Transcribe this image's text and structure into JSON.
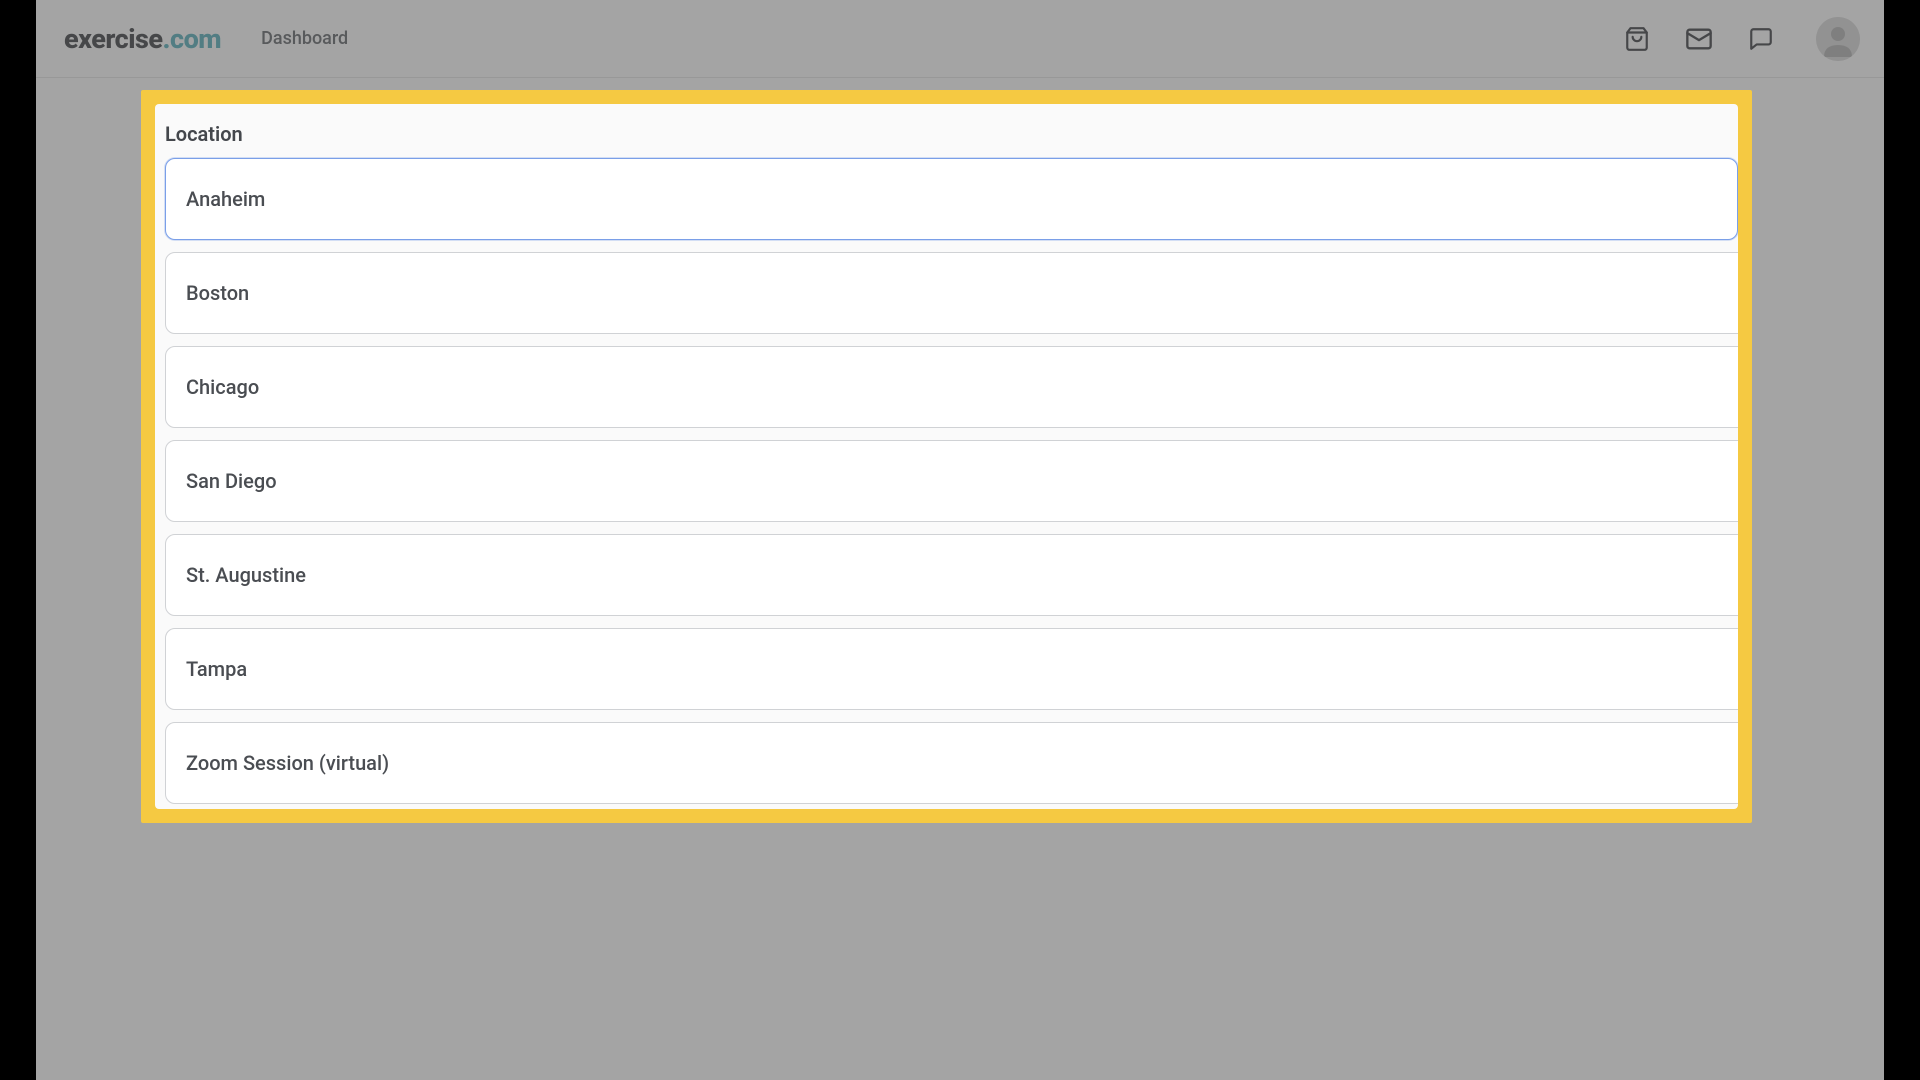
{
  "header": {
    "logo_first": "exercise",
    "logo_second": ".com",
    "nav": "Dashboard"
  },
  "modal": {
    "title": "Location",
    "options": [
      {
        "label": "Anaheim",
        "selected": true
      },
      {
        "label": "Boston",
        "selected": false
      },
      {
        "label": "Chicago",
        "selected": false
      },
      {
        "label": "San Diego",
        "selected": false
      },
      {
        "label": "St. Augustine",
        "selected": false
      },
      {
        "label": "Tampa",
        "selected": false
      },
      {
        "label": "Zoom Session (virtual)",
        "selected": false
      }
    ]
  }
}
